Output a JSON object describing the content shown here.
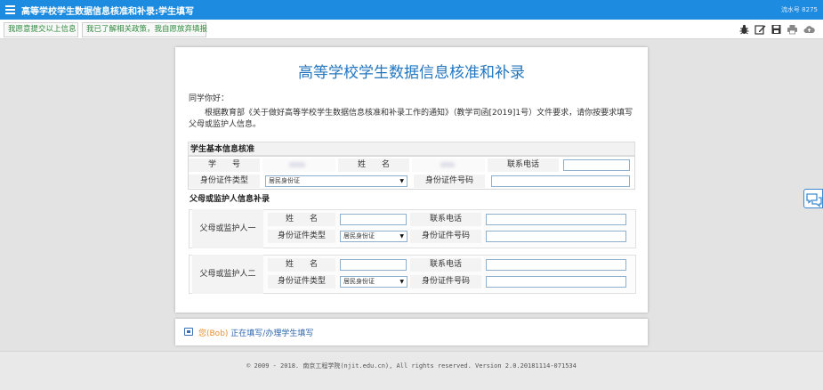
{
  "topbar": {
    "title": "高等学校学生数据信息核准和补录:学生填写",
    "serial_label": "流水号",
    "serial_value": "8275"
  },
  "toolbar": {
    "submit_label": "我愿意提交以上信息",
    "abandon_label": "我已了解相关政策，我自愿放弃填报",
    "icons": [
      "bug-icon",
      "edit-icon",
      "save-icon",
      "print-icon",
      "cloud-icon"
    ]
  },
  "form": {
    "title": "高等学校学生数据信息核准和补录",
    "greeting": "同学你好：",
    "paragraph": "根据教育部《关于做好高等学校学生数据信息核准和补录工作的通知》（教学司函[2019]1号）文件要求，请你按要求填写父母或监护人信息。",
    "section_student": "学生基本信息核准",
    "section_guardian": "父母或监护人信息补录",
    "student_id_label": "学　　号",
    "student_name_label": "姓　　名",
    "phone_label": "联系电话",
    "id_type_label": "身份证件类型",
    "id_type_value": "居民身份证",
    "id_number_label": "身份证件号码",
    "guardian1_label": "父母或监护人一",
    "guardian2_label": "父母或监护人二",
    "guardian_name_label": "姓　　名",
    "guardian_phone_label": "联系电话",
    "guardian_id_type_label": "身份证件类型",
    "guardian_id_type_value": "居民身份证",
    "guardian_id_number_label": "身份证件号码"
  },
  "status": {
    "user": "您(Bob)",
    "mid": "正在填写/办理",
    "task": "学生填写"
  },
  "footer": {
    "text": "© 2009 - 2018. 南京工程学院(njit.edu.cn), All rights reserved. Version 2.0.20181114-071534"
  },
  "colors": {
    "topbar": "#1d8ce0",
    "title": "#2477bf",
    "toolbar_button_text": "#2e8a3c",
    "user_highlight": "#e8912d"
  }
}
